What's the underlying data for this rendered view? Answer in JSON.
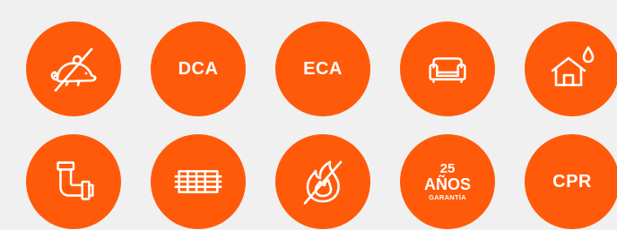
{
  "badges": {
    "dca": "DCA",
    "eca": "ECA",
    "cpr": "CPR",
    "warranty": {
      "number": "25",
      "word": "AÑOS",
      "caption": "GARANTÍA"
    }
  },
  "icons": [
    "no-rodents-icon",
    "sofa-icon",
    "house-moisture-icon",
    "pipe-icon",
    "grid-mesh-icon",
    "no-fire-icon"
  ],
  "colors": {
    "background": "#f0f0f0",
    "badge": "#ff5a0a",
    "icon": "#ffffff"
  }
}
